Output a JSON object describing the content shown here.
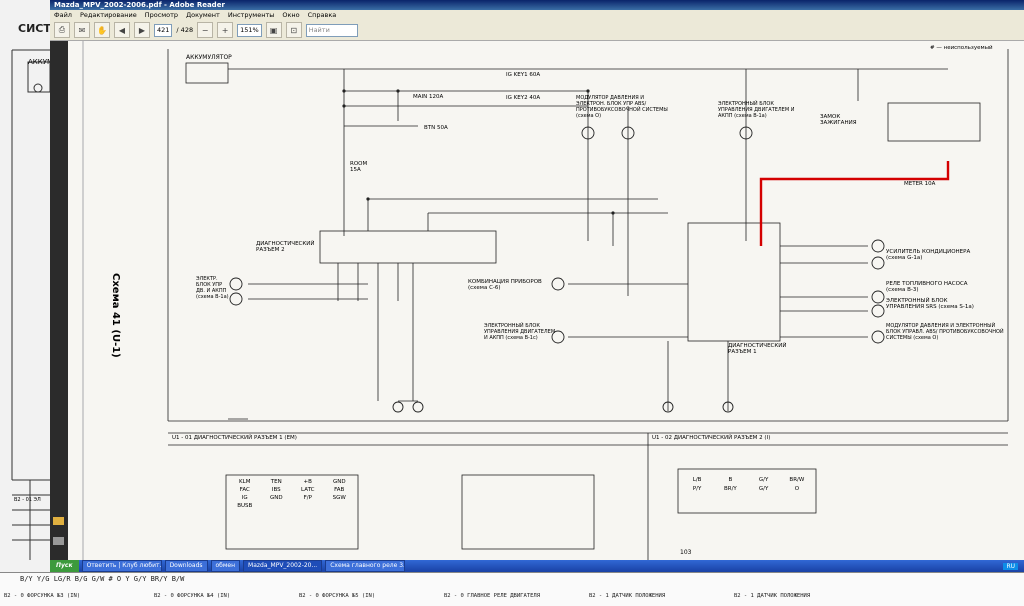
{
  "window": {
    "title": "Mazda_MPV_2002-2006.pdf - Adobe Reader"
  },
  "menu": [
    "Файл",
    "Редактирование",
    "Просмотр",
    "Документ",
    "Инструменты",
    "Окно",
    "Справка"
  ],
  "toolbar": {
    "page_current": "421",
    "page_total": "/ 428",
    "zoom": "151%",
    "search_placeholder": "Найти"
  },
  "left": {
    "heading": "СИСТ",
    "battery": "АККУМ"
  },
  "diagram": {
    "vertical_label": "Схема 41 (U-1)",
    "legend": "# — неиспользуемый",
    "battery": "АККУМУЛЯТОР",
    "main_fuse": "MAIN 120A",
    "btn_fuse": "BTN 50A",
    "ig_key1": "IG KEY1 60A",
    "ig_key2": "IG KEY2 40A",
    "room_fuse": "ROOM 15A",
    "meter_fuse": "METER 10A",
    "ign_lock": "ЗАМОК ЗАЖИГАНИЯ",
    "abs_mod": "МОДУЛЯТОР ДАВЛЕНИЯ И ЭЛЕКТРОН. БЛОК УПР ABS/ ПРОТИВОБУКСОВОЧНОЙ СИСТЕМЫ (схема O)",
    "ecu_top": "ЭЛЕКТРОННЫЙ БЛОК УПРАВЛЕНИЯ ДВИГАТЕЛЕМ И АКПП (схема B-1a)",
    "diag2": "ДИАГНОСТИЧЕСКИЙ РАЗЪЕМ 2",
    "ecu_left": "ЭЛЕКТР. БЛОК УПР ДВ. И АКПП (схема B-1a)",
    "cluster": "КОМБИНАЦИЯ ПРИБОРОВ (схема C-6)",
    "ecu_bottom": "ЭЛЕКТРОННЫЙ БЛОК УПРАВЛЕНИЯ ДВИГАТЕЛЕМ И АКПП (схема B-1c)",
    "diag1": "ДИАГНОСТИЧЕСКИЙ РАЗЪЕМ 1",
    "ac_amp": "УСИЛИТЕЛЬ КОНДИЦИОНЕРА (схема G-1a)",
    "fuel_relay": "РЕЛЕ ТОПЛИВНОГО НАСОСА (схема B-3)",
    "srs": "ЭЛЕКТРОННЫЙ БЛОК УПРАВЛЕНИЯ SRS (схема S-1a)",
    "abs_right": "МОДУЛЯТОР ДАВЛЕНИЯ И ЭЛЕКТРОННЫЙ БЛОК УПРАВЛ. ABS/ ПРОТИВОБУКСОВОЧНОЙ СИСТЕМЫ (схема O)",
    "conn1_title": "U1 - 01 ДИАГНОСТИЧЕСКИЙ РАЗЪЕМ 1 (EM)",
    "conn2_title": "U1 - 02 ДИАГНОСТИЧЕСКИЙ РАЗЪЕМ 2 (I)",
    "conn1_pins": [
      "KLM",
      "TEN",
      "+B",
      "GND",
      "FAC",
      "IBS",
      "LATC",
      "FAB",
      "IG",
      "GND",
      "F/P",
      "SGW",
      "BUSB"
    ],
    "conn2_pins": [
      "L/B",
      "B",
      "G/Y",
      "BR/W",
      "P/Y",
      "BR/Y",
      "G/Y",
      "O"
    ],
    "page_num": "103"
  },
  "taskbar": {
    "start": "Пуск",
    "items": [
      "Ответить | Клуб любит...",
      "Downloads",
      "обмен",
      "Mazda_MPV_2002-20...",
      "Схема главного реле 3..."
    ],
    "lang": "RU"
  },
  "bottom": {
    "cells": [
      "B2 - 0 ФОРСУНКА №3 (IN)",
      "B2 - 0 ФОРСУНКА №4 (IN)",
      "B2 - 0 ФОРСУНКА №5 (IN)",
      "B2 - 0 ГЛАВНОЕ РЕЛЕ ДВИГАТЕЛЯ",
      "B2 - 1 ДАТЧИК ПОЛОЖЕНИЯ",
      "B2 - 1 ДАТЧИК ПОЛОЖЕНИЯ"
    ],
    "row": "B/Y  Y/G  LG/R  B/G  G/W  #  O  Y  G/Y  BR/Y  B/W",
    "side_label": "B2 - 01 ЭЛ"
  },
  "colors": {
    "highlight": "#d40000",
    "wire": "#222222"
  }
}
